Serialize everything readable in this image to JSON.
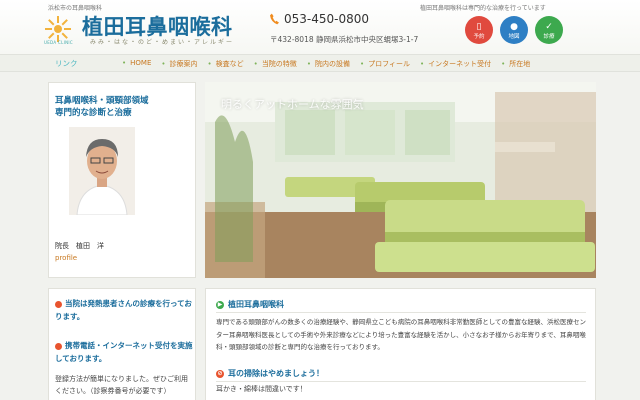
{
  "header": {
    "tagline": "浜松市の耳鼻咽喉科",
    "logo_subtext": "UEDA CLINIC",
    "clinic_name": "植田耳鼻咽喉科",
    "clinic_sub": "みみ・はな・のど・めまい・アレルギー",
    "phone": "053-450-0800",
    "address": "〒432-8018 静岡県浜松市中央区蜆塚3-1-7",
    "notice": "植田耳鼻咽喉科は専門的な治療を行っています",
    "quick_buttons": [
      {
        "label": "予約",
        "icon": "smartphone-icon",
        "color": "#e04a3e"
      },
      {
        "label": "地図",
        "icon": "map-pin-icon",
        "color": "#2e7fc4"
      },
      {
        "label": "診療",
        "icon": "calendar-check-icon",
        "color": "#3da94e"
      }
    ]
  },
  "nav": {
    "link_label": "リンク",
    "items": [
      "HOME",
      "診療案内",
      "検査など",
      "当院の特徴",
      "院内の設備",
      "プロフィール",
      "インターネット受付",
      "所在地"
    ]
  },
  "doctor": {
    "title_line1": "耳鼻咽喉科・頭頸部領域",
    "title_line2": "専門的な診断と治療",
    "name": "院長　植田　洋",
    "profile_link": "profile"
  },
  "photo": {
    "caption": "明るくアットホームな雰囲気"
  },
  "notes": {
    "note1": "当院は発熱患者さんの診療を行っております。",
    "note2": "携帯電話・インターネット受付を実施しております。",
    "note2_body": "登録方法が簡単になりました。ぜひご利用ください。（診察券番号が必要です）"
  },
  "main": {
    "section1_title": "植田耳鼻咽喉科",
    "section1_body": "専門である頭頸部がんの数多くの治療経験や、静岡県立こども病院の耳鼻咽喉科非常勤医師としての豊富な経験、浜松医療センター耳鼻咽喉科医長としての手術や外来診療などにより培った豊富な経験を活かし、小さなお子様からお年寄りまで、耳鼻咽喉科・頭頸部領域の診断と専門的な治療を行っております。",
    "section2_title": "耳の掃除はやめましょう！",
    "section2_body": "耳かき・綿棒は間違いです！"
  }
}
